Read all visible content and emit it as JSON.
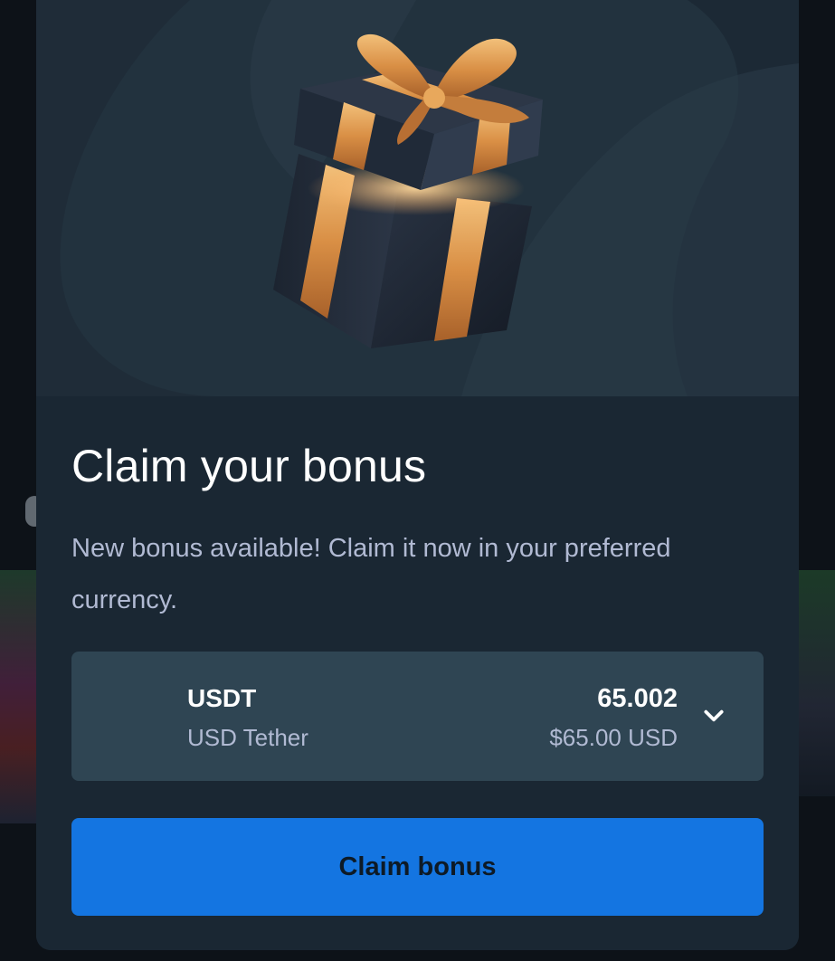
{
  "modal": {
    "title": "Claim your bonus",
    "subtitle": "New bonus available! Claim it now in your preferred currency.",
    "hero_icon": "gift-box-icon",
    "currency": {
      "code": "USDT",
      "name": "USD Tether",
      "amount": "65.002",
      "usd_value": "$65.00 USD",
      "dropdown_icon": "chevron-down-icon"
    },
    "claim_button_label": "Claim bonus"
  },
  "colors": {
    "modal_background": "#1a2733",
    "hero_background": "#22323e",
    "select_background": "#2f4553",
    "primary_button": "#1475e1",
    "text_primary": "#ffffff",
    "text_secondary": "#b1bad3",
    "gift_ribbon": "#d9954a"
  }
}
